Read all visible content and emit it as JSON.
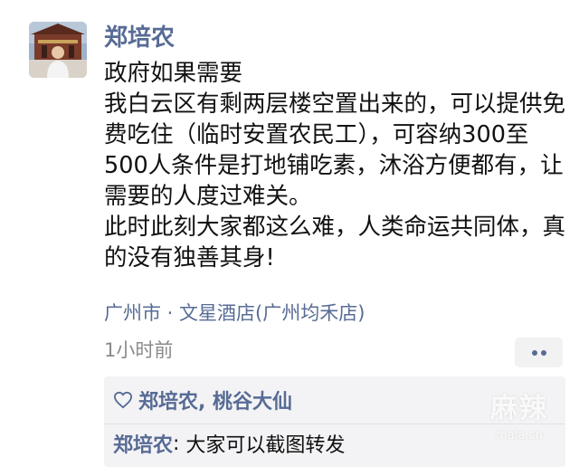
{
  "post": {
    "author": "郑培农",
    "avatar_icon": "avatar-photo-icon",
    "text": "政府如果需要\n我白云区有剩两层楼空置出来的，可以提供免费吃住（临时安置农民工），可容纳300至500人条件是打地铺吃素，沐浴方便都有，让需要的人度过难关。\n此时此刻大家都这么难，人类命运共同体，真的没有独善其身!",
    "location": "广州市 · 文星酒店(广州均禾店)",
    "time": "1小时前",
    "more_icon": "more-dots-icon"
  },
  "likes": {
    "icon": "heart-icon",
    "names": "郑培农, 桃谷大仙"
  },
  "comments": [
    {
      "author": "郑培农",
      "separator": ": ",
      "text": "大家可以截图转发"
    }
  ],
  "watermark": {
    "main": "麻辣",
    "sub": "mala.cn"
  },
  "colors": {
    "link": "#576b95",
    "text": "#111111",
    "meta": "#8a8a8a",
    "panel": "#f3f3f5"
  }
}
